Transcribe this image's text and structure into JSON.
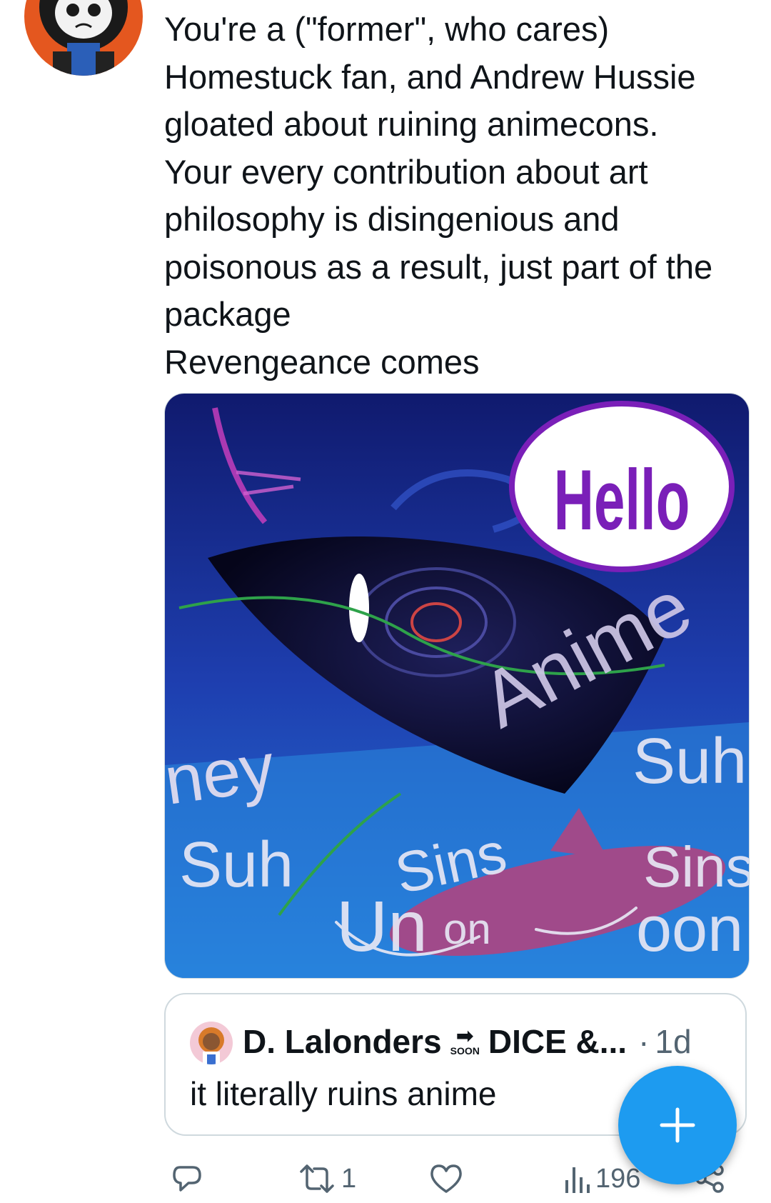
{
  "tweet": {
    "text_lines": [
      "You're a (\"former\", who cares)",
      "Homestuck fan, and Andrew Hussie",
      "gloated about ruining animecons.",
      "Your every contribution about art",
      "philosophy is disingenious and",
      "poisonous as a result, just part of the",
      "package",
      "Revengeance comes"
    ],
    "media": {
      "bubble_text": "Hello",
      "scribbles": [
        "Anime",
        "Suh",
        "ney",
        "Suh",
        "Un",
        "Sins",
        "on",
        "Sins",
        "oon"
      ]
    }
  },
  "quote": {
    "author": "D. Lalonders",
    "badge_label": "SOON",
    "badge_arrow": "➡",
    "suffix": "DICE &...",
    "separator": "·",
    "time": "1d",
    "text": "it literally ruins anime"
  },
  "actions": {
    "retweets": "1",
    "views": "196"
  },
  "colors": {
    "accent": "#1d9bf0",
    "icon_gray": "#536471",
    "bubble_outline": "#7a1fb8"
  },
  "icons": [
    "reply-icon",
    "retweet-icon",
    "like-icon",
    "views-icon",
    "share-icon",
    "compose-plus-icon"
  ]
}
